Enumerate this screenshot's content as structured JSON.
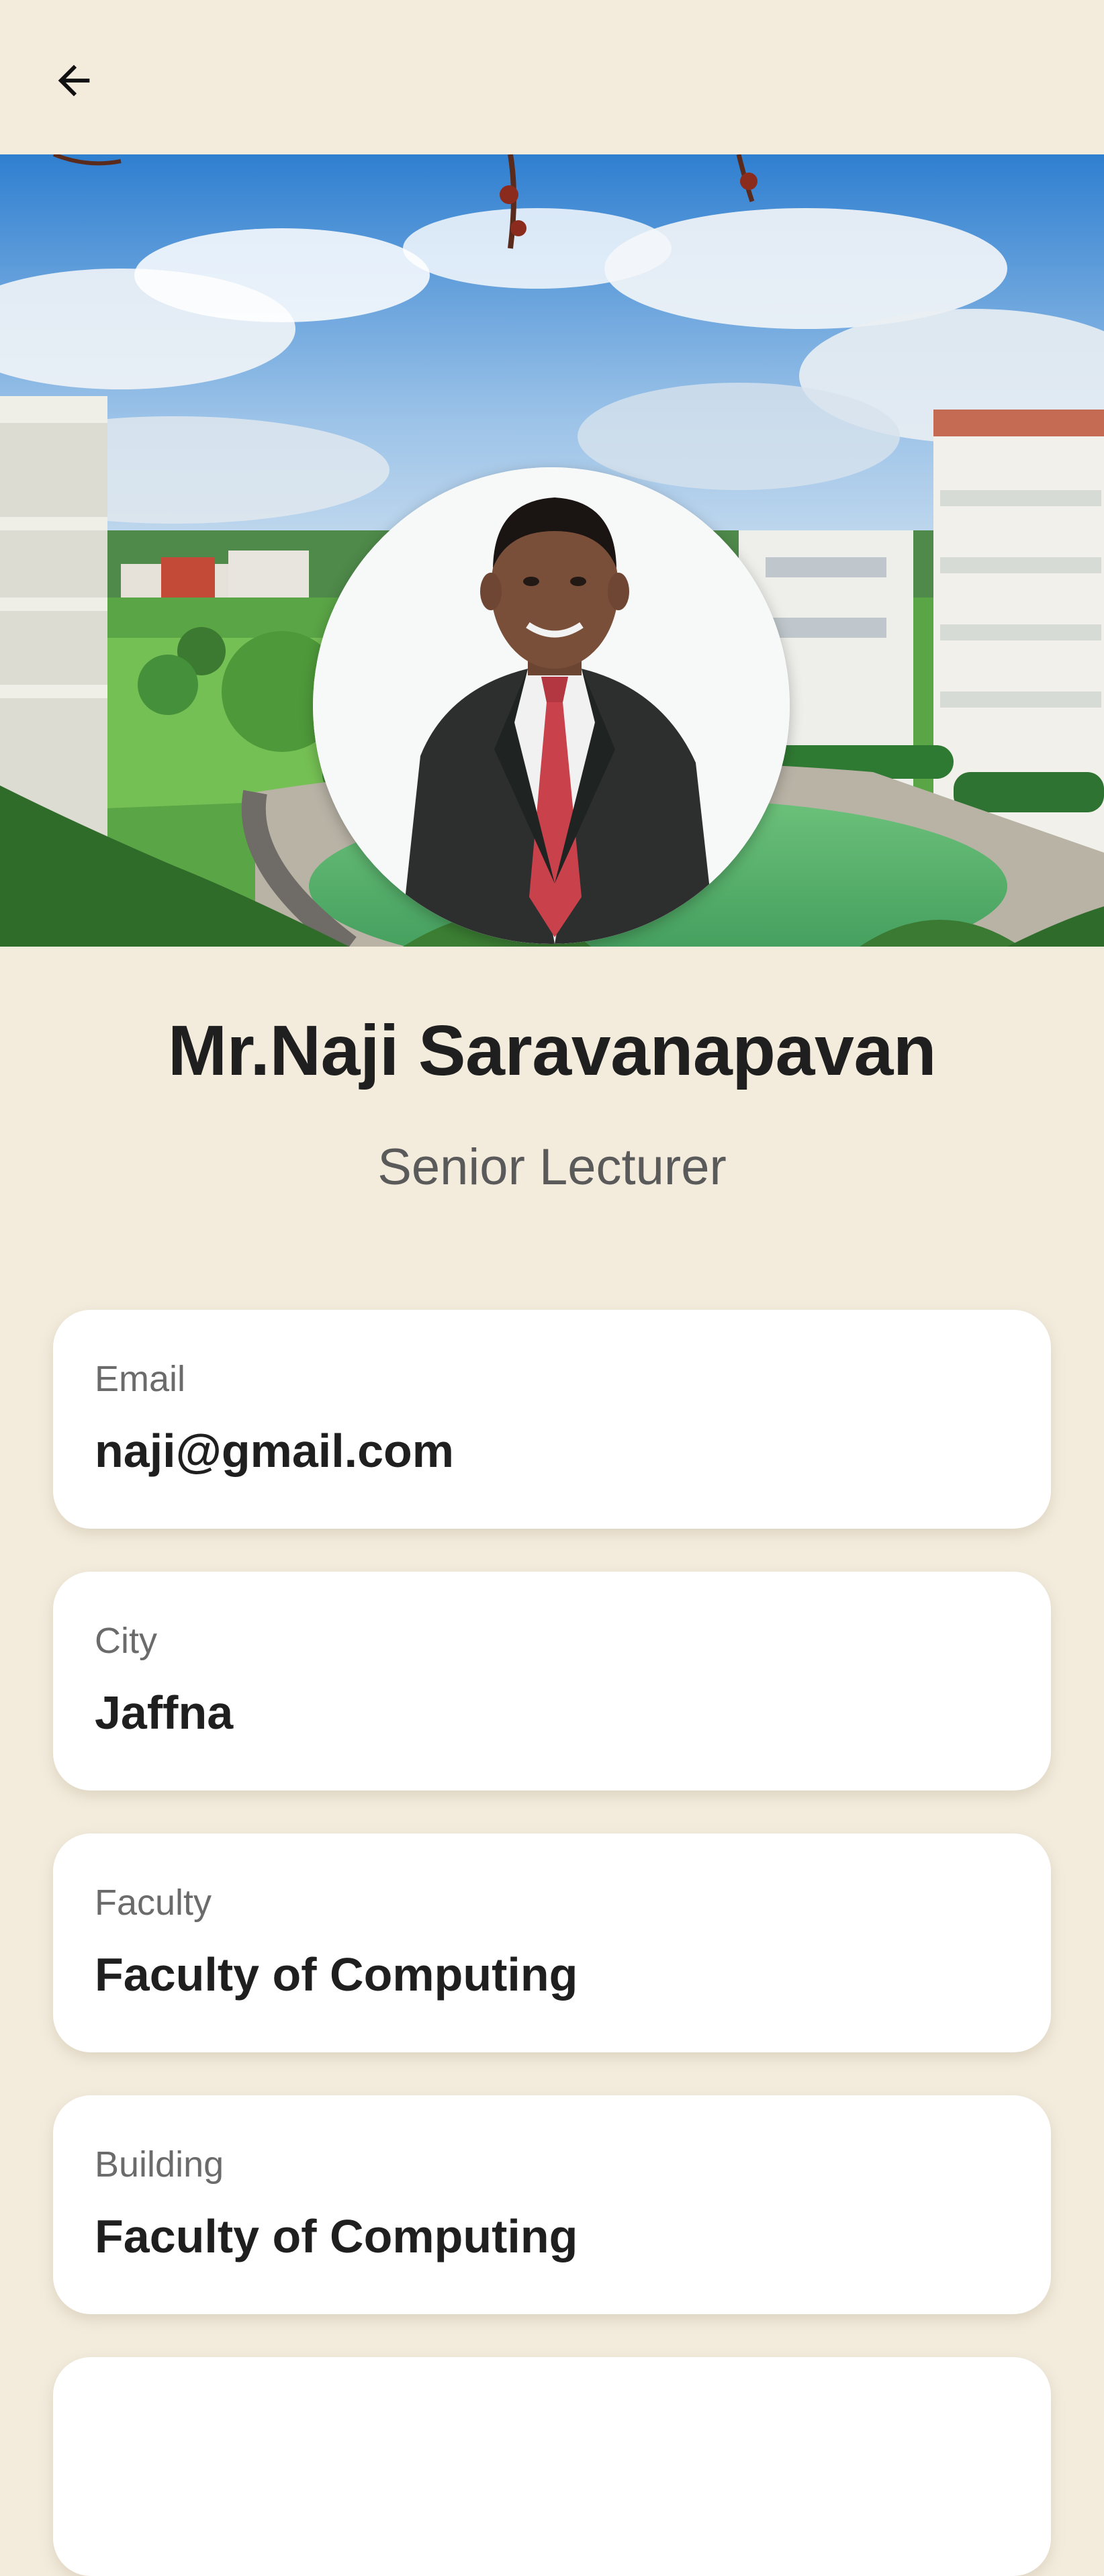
{
  "header": {
    "back_icon": "arrow-left-icon"
  },
  "hero": {
    "background": "campus-photo",
    "avatar": "lecturer-portrait"
  },
  "profile": {
    "name": "Mr.Naji Saravanapavan",
    "role": "Senior Lecturer"
  },
  "details": [
    {
      "label": "Email",
      "value": "naji@gmail.com"
    },
    {
      "label": "City",
      "value": "Jaffna"
    },
    {
      "label": "Faculty",
      "value": "Faculty of Computing"
    },
    {
      "label": "Building",
      "value": "Faculty of Computing"
    }
  ],
  "colors": {
    "background": "#f3ecdd",
    "card": "#ffffff",
    "text_primary": "#1f1f1f",
    "text_secondary": "#6b6b6b"
  }
}
